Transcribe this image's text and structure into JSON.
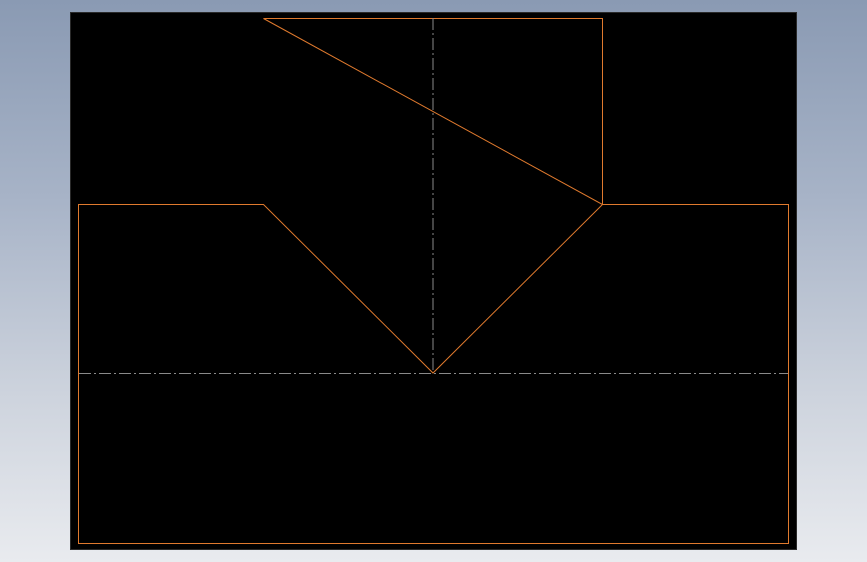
{
  "window": {
    "title": ""
  },
  "viewport": {
    "background_color": "#000000",
    "outline_color": "#e07a2e",
    "centerline_color": "#8a8a8a",
    "description_label": ""
  },
  "colors": {
    "app_background_top": "#8a9ab3",
    "app_background_bottom": "#e9ebef"
  }
}
